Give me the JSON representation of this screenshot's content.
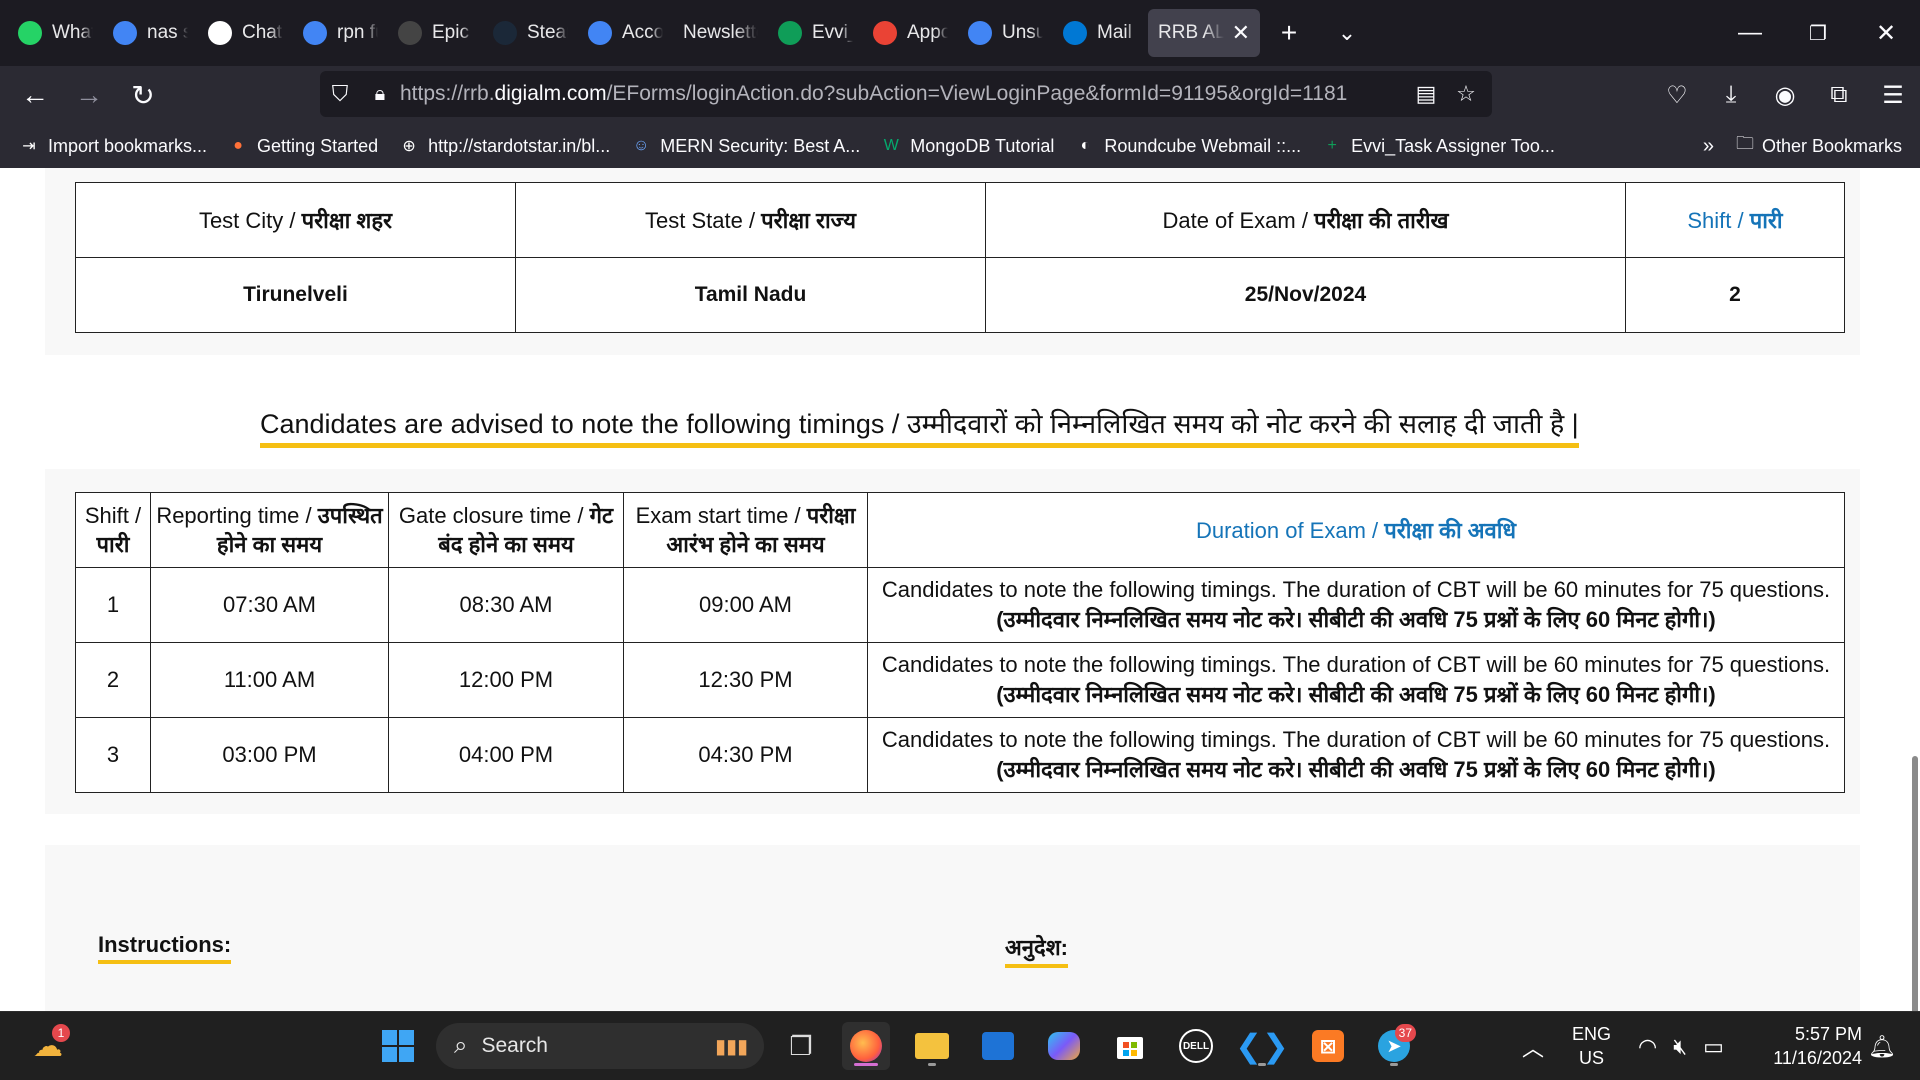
{
  "browser": {
    "tabs": [
      {
        "label": "Whats",
        "icon": "whatsapp-icon",
        "color": "#25d366"
      },
      {
        "label": "nas se",
        "icon": "google-icon",
        "color": "#4285f4"
      },
      {
        "label": "ChatG",
        "icon": "chatgpt-icon",
        "color": "#ffffff"
      },
      {
        "label": "rpn fu",
        "icon": "google-icon",
        "color": "#4285f4"
      },
      {
        "label": "Epic G",
        "icon": "epic-games-icon",
        "color": "#444444"
      },
      {
        "label": "Steam",
        "icon": "steam-icon",
        "color": "#1b2838"
      },
      {
        "label": "Accou",
        "icon": "docs-icon",
        "color": "#4285f4"
      },
      {
        "label": "Newslette",
        "icon": "",
        "color": ""
      },
      {
        "label": "Evvi_T",
        "icon": "sheets-icon",
        "color": "#0f9d58"
      },
      {
        "label": "Appoi",
        "icon": "gmail-icon",
        "color": "#ea4335"
      },
      {
        "label": "Unsub",
        "icon": "google-icon",
        "color": "#4285f4"
      },
      {
        "label": "Mail -",
        "icon": "outlook-icon",
        "color": "#0078d4"
      },
      {
        "label": "RRB ALI",
        "icon": "",
        "color": ""
      }
    ],
    "url": {
      "prefix": "https://rrb.",
      "domain": "digialm.com",
      "path": "/EForms/loginAction.do?subAction=ViewLoginPage&formId=91195&orgId=1181"
    },
    "bookmarks": [
      {
        "label": "Import bookmarks...",
        "icon": "import-icon"
      },
      {
        "label": "Getting Started",
        "icon": "firefox-icon"
      },
      {
        "label": "http://stardotstar.in/bl...",
        "icon": "globe-icon"
      },
      {
        "label": "MERN Security: Best A...",
        "icon": "user-icon"
      },
      {
        "label": "MongoDB Tutorial",
        "icon": "w3schools-icon"
      },
      {
        "label": "Roundcube Webmail ::...",
        "icon": "roundcube-icon"
      },
      {
        "label": "Evvi_Task Assigner Too...",
        "icon": "sheets-icon"
      }
    ],
    "other_bookmarks": "Other Bookmarks"
  },
  "exam_info": {
    "headers": [
      {
        "en": "Test City / ",
        "hi": "परीक्षा शहर"
      },
      {
        "en": "Test State / ",
        "hi": "परीक्षा राज्य"
      },
      {
        "en": "Date of Exam / ",
        "hi": "परीक्षा की तारीख"
      },
      {
        "en": "Shift / ",
        "hi": "पारी"
      }
    ],
    "values": [
      "Tirunelveli",
      "Tamil Nadu",
      "25/Nov/2024",
      "2"
    ]
  },
  "advice": "Candidates are advised to note the following timings / उम्मीदवारों को निम्नलिखित समय को नोट करने की सलाह दी जाती है |",
  "timings": {
    "headers": [
      {
        "en": "Shift / ",
        "hi": "पारी"
      },
      {
        "en": "Reporting time / ",
        "hi": "उपस्थित होने का समय"
      },
      {
        "en": "Gate closure time / ",
        "hi": "गेट बंद होने का समय"
      },
      {
        "en": "Exam start time / ",
        "hi": "परीक्षा आरंभ होने का समय"
      },
      {
        "en": "Duration of Exam / ",
        "hi": "परीक्षा की अवधि"
      }
    ],
    "rows": [
      {
        "shift": "1",
        "reporting": "07:30 AM",
        "gate": "08:30 AM",
        "start": "09:00 AM",
        "duration_en": "Candidates to note the following timings. The duration of CBT will be 60 minutes for 75 questions.",
        "duration_hi": "(उम्मीदवार निम्नलिखित समय नोट करे। सीबीटी की अवधि 75 प्रश्नों के लिए 60 मिनट होगी।)"
      },
      {
        "shift": "2",
        "reporting": "11:00 AM",
        "gate": "12:00 PM",
        "start": "12:30 PM",
        "duration_en": "Candidates to note the following timings. The duration of CBT will be 60 minutes for 75 questions.",
        "duration_hi": "(उम्मीदवार निम्नलिखित समय नोट करे। सीबीटी की अवधि 75 प्रश्नों के लिए 60 मिनट होगी।)"
      },
      {
        "shift": "3",
        "reporting": "03:00 PM",
        "gate": "04:00 PM",
        "start": "04:30 PM",
        "duration_en": "Candidates to note the following timings. The duration of CBT will be 60 minutes for 75 questions.",
        "duration_hi": "(उम्मीदवार निम्नलिखित समय नोट करे। सीबीटी की अवधि 75 प्रश्नों के लिए 60 मिनट होगी।)"
      }
    ]
  },
  "instructions": {
    "en": "Instructions:",
    "hi": "अनुदेश:"
  },
  "taskbar": {
    "search_label": "Search",
    "weather_badge": "1",
    "telegram_badge": "37",
    "lang_line1": "ENG",
    "lang_line2": "US",
    "time": "5:57 PM",
    "date": "11/16/2024"
  },
  "colors": {
    "accent_yellow": "#f5bf13",
    "link_blue": "#1574b8",
    "tab_bg": "#1c1b22",
    "toolbar_bg": "#2b2a33",
    "taskbar_bg": "#202020"
  }
}
